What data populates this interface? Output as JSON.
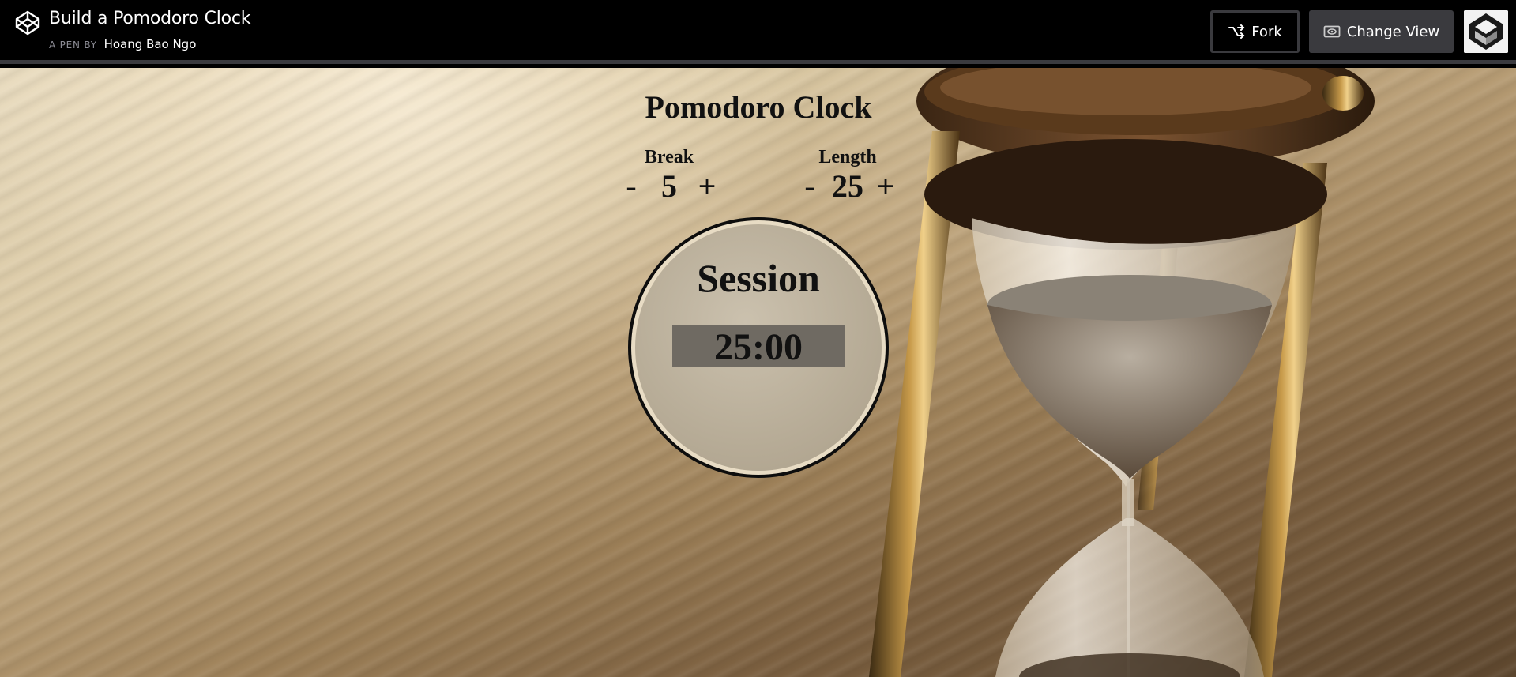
{
  "header": {
    "title": "Build a Pomodoro Clock",
    "by_prefix": "A PEN BY",
    "author": "Hoang Bao Ngo",
    "fork_label": "Fork",
    "change_view_label": "Change View"
  },
  "app": {
    "title": "Pomodoro Clock",
    "break": {
      "label": "Break",
      "minus": "-",
      "value": "5",
      "plus": "+"
    },
    "length": {
      "label": "Length",
      "minus": "-",
      "value": "25",
      "plus": "+"
    },
    "clock": {
      "label": "Session",
      "time": "25:00"
    }
  },
  "icons": {
    "logo": "codepen-logo-icon",
    "fork": "fork-icon",
    "change_view": "eye-icon",
    "avatar": "codepen-avatar-icon"
  },
  "colors": {
    "topbar_bg": "#000000",
    "button_gray": "#3a3a3e",
    "timer_box": "#6f6a62"
  }
}
